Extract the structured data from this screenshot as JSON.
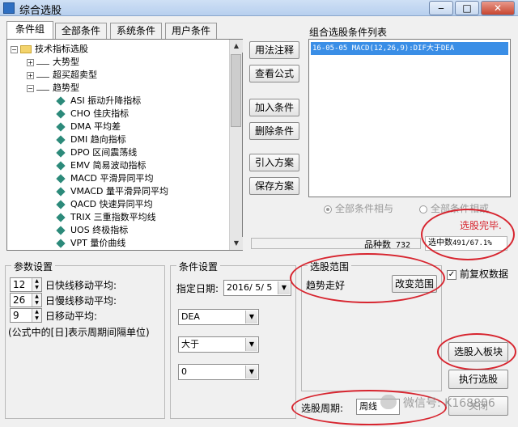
{
  "window": {
    "title": "综合选股",
    "close_glyph": "✕",
    "minimize_glyph": "‒",
    "maximize_glyph": "□"
  },
  "tabs": [
    {
      "label": "条件组",
      "active": true
    },
    {
      "label": "全部条件",
      "active": false
    },
    {
      "label": "系统条件",
      "active": false
    },
    {
      "label": "用户条件",
      "active": false
    }
  ],
  "tree": {
    "root": "技术指标选股",
    "groups": [
      "大势型",
      "超买超卖型",
      "趋势型"
    ],
    "items": [
      "ASI 振动升降指标",
      "CHO 佳庆指标",
      "DMA 平均差",
      "DMI 趋向指标",
      "DPO 区间震荡线",
      "EMV 简易波动指标",
      "MACD 平滑异同平均",
      "VMACD 量平滑异同平均",
      "QACD 快速异同平均",
      "TRIX 三重指数平均线",
      "UOS 终极指标",
      "VPT 量价曲线"
    ]
  },
  "middle_buttons": [
    "用法注释",
    "查看公式",
    "加入条件",
    "删除条件",
    "引入方案",
    "保存方案"
  ],
  "condition_list": {
    "title": "组合选股条件列表",
    "items": [
      "16-05-05 MACD(12,26,9):DIF大于DEA"
    ]
  },
  "logic": {
    "and_label": "全部条件相与",
    "or_label": "全部条件相或"
  },
  "status": {
    "done_text": "选股完毕.",
    "count_label": "品种数",
    "count_value": "732",
    "hit_label": "选中数",
    "hit_value": "491/67.1%"
  },
  "params": {
    "title": "参数设置",
    "rows": [
      {
        "value": "12",
        "label": "日快线移动平均:"
      },
      {
        "value": "26",
        "label": "日慢线移动平均:"
      },
      {
        "value": "9",
        "label": "日移动平均:"
      }
    ],
    "note": "(公式中的[日]表示周期间隔单位)"
  },
  "cond_setting": {
    "title": "条件设置",
    "date_label": "指定日期:",
    "date_value": "2016/ 5/ 5",
    "select1": "DEA",
    "select2": "大于",
    "select3": "0"
  },
  "range": {
    "title": "选股范围",
    "value": "趋势走好",
    "change_button": "改变范围"
  },
  "restore": {
    "label": "前复权数据",
    "checked": true
  },
  "right_buttons": {
    "to_block": "选股入板块",
    "execute": "执行选股"
  },
  "period": {
    "label": "选股周期:",
    "value": "周线"
  },
  "watermark": "微信号: K168806",
  "bottom_button_partial": "关闭",
  "annotation_color": "#d7252f",
  "selection_color": "#3a8ee6"
}
